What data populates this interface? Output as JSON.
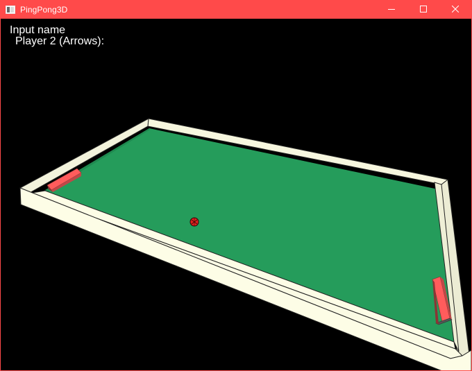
{
  "window": {
    "title": "PingPong3D",
    "icon": "app-window-icon",
    "controls": [
      "minimize-icon",
      "maximize-icon",
      "close-icon"
    ],
    "frame_color": "#ff4a4a"
  },
  "hud": {
    "line1": "Input name",
    "line2": "Player 2 (Arrows):"
  },
  "scene": {
    "table_color": "#259c5b",
    "wall_color": "#fdfde6",
    "paddle_color": "#ff5c5c",
    "ball_color": "#e0211e",
    "background": "#000000"
  }
}
